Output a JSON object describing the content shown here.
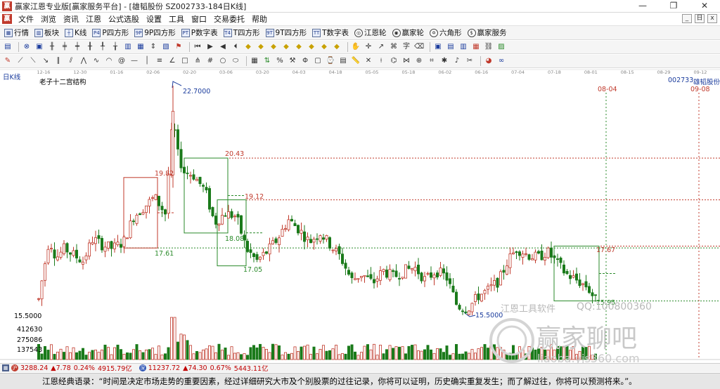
{
  "window": {
    "title": "赢家江恩专业版[赢家服务平台] - [雄韬股份 SZ002733-184日K线]",
    "minimize": "—",
    "restore": "❐",
    "close": "✕"
  },
  "menubar": {
    "items": [
      "文件",
      "浏览",
      "资讯",
      "江恩",
      "公式选股",
      "设置",
      "工具",
      "窗口",
      "交易委托",
      "帮助"
    ],
    "mdi": [
      "_",
      "日",
      "x"
    ]
  },
  "toolbar1": {
    "items": [
      {
        "label": "行情",
        "icon": "grid-icon"
      },
      {
        "label": "板块",
        "icon": "blocks-icon"
      },
      {
        "label": "K线",
        "icon": "kline-icon"
      },
      {
        "label": "P四方形",
        "icon": "square-icon",
        "tag": "P4"
      },
      {
        "label": "9P四方形",
        "icon": "square-icon",
        "tag": "9P"
      },
      {
        "label": "P数字表",
        "icon": "table-icon",
        "tag": "PT"
      },
      {
        "label": "T四方形",
        "icon": "square-icon",
        "tag": "T4"
      },
      {
        "label": "9T四方形",
        "icon": "square-icon",
        "tag": "9T"
      },
      {
        "label": "T数字表",
        "icon": "table-icon",
        "tag": "TT"
      },
      {
        "label": "江恩轮",
        "icon": "wheel-icon"
      },
      {
        "label": "赢家轮",
        "icon": "wheel-icon"
      },
      {
        "label": "六角形",
        "icon": "hexagon-icon"
      },
      {
        "label": "赢家服务",
        "icon": "service-icon"
      }
    ]
  },
  "chart_header": {
    "period": "日K线",
    "study": "老子十二宫结构",
    "stock_code": "002733",
    "stock_name": "雄韬股份"
  },
  "chart_data": {
    "type": "candlestick",
    "x_ticks": [
      "12-16",
      "12-30",
      "01-16",
      "02-06",
      "02-20",
      "03-06",
      "03-20",
      "04-03",
      "04-18",
      "05-05",
      "05-18",
      "06-02",
      "06-16",
      "07-04",
      "07-18",
      "08-01",
      "08-15",
      "08-29",
      "09-12"
    ],
    "price_range": [
      15.5,
      22.7
    ],
    "high_label": "22.7000",
    "low_label": "15.5000",
    "left_axis_price": "15.5000",
    "levels": [
      {
        "label": "20.43",
        "color": "#c0392b"
      },
      {
        "label": "19.82",
        "color": "#c0392b"
      },
      {
        "label": "19.12",
        "color": "#c0392b"
      },
      {
        "label": "18.08",
        "color": "#2a8a2a"
      },
      {
        "label": "17.61",
        "color": "#2a8a2a"
      },
      {
        "label": "17.67",
        "color": "#c0392b"
      },
      {
        "label": "17.05",
        "color": "#2a8a2a"
      },
      {
        "label": "15.95",
        "color": "#2a8a2a"
      }
    ],
    "date_markers": [
      {
        "label": "08-04",
        "color": "#c0392b"
      },
      {
        "label": "09-08",
        "color": "#c0392b"
      }
    ],
    "volume_ticks": [
      "412630",
      "275086",
      "137543"
    ],
    "up_color": "#c0392b",
    "down_color": "#1a7a1a"
  },
  "watermark": {
    "software": "江恩工具软件",
    "qq": "QQ:100800360",
    "site": "赢家聊吧",
    "url": "liaoba.yjs360.com"
  },
  "status": {
    "index1_value": "3288.24",
    "index1_change": "▲7.78",
    "index1_pct": "0.24%",
    "index1_amount": "4915.79亿",
    "index2_value": "11237.72",
    "index2_change": "▲74.30",
    "index2_pct": "0.67%",
    "index2_amount": "5443.11亿"
  },
  "quote": "江恩经典语录：“时间是决定市场走势的重要因素，经过详细研究大市及个别股票的过往记录，你将可以证明，历史确实重复发生；而了解过往，你将可以预测将来。”。"
}
